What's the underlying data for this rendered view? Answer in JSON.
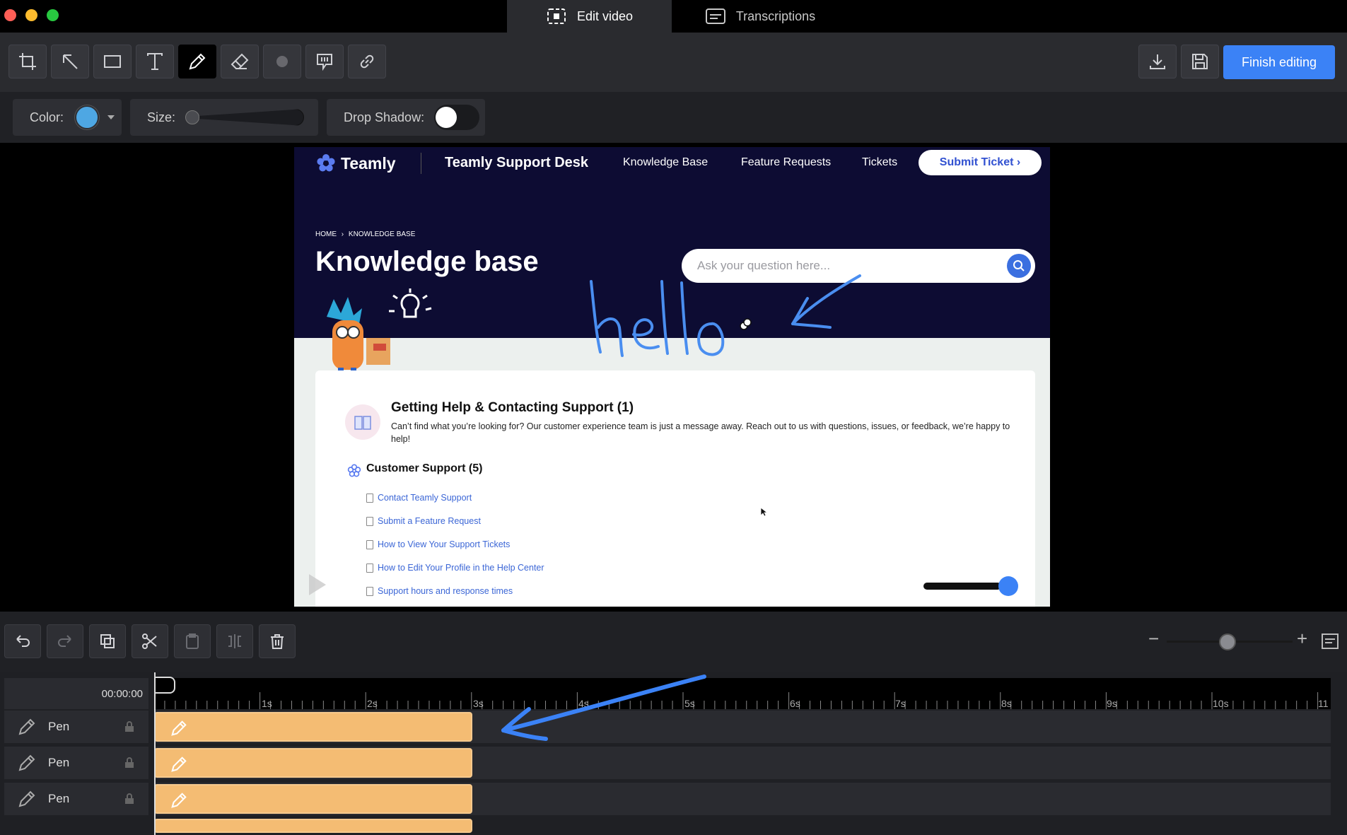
{
  "window": {
    "tabs": [
      {
        "label": "Edit video",
        "active": true,
        "icon": "edit-video-icon"
      },
      {
        "label": "Transcriptions",
        "active": false,
        "icon": "transcript-icon"
      }
    ]
  },
  "toolbar": {
    "tools": [
      "crop-icon",
      "arrow-icon",
      "rectangle-icon",
      "text-icon",
      "pen-icon",
      "eraser-icon",
      "blur-icon",
      "spotlight-icon",
      "link-icon"
    ],
    "active_tool": "pen-icon",
    "finish_label": "Finish editing"
  },
  "options": {
    "color_label": "Color:",
    "color_value": "#4ea7e3",
    "size_label": "Size:",
    "size_value": 0,
    "shadow_label": "Drop Shadow:",
    "shadow_on": false
  },
  "video": {
    "logo": "Teamly",
    "desk_title": "Teamly Support Desk",
    "nav": [
      "Knowledge Base",
      "Feature Requests",
      "Tickets"
    ],
    "submit": "Submit Ticket ›",
    "breadcrumb_home": "HOME",
    "breadcrumb_sep": "›",
    "breadcrumb_current": "KNOWLEDGE BASE",
    "title": "Knowledge base",
    "search_placeholder": "Ask your question here...",
    "annotation_text": "hello",
    "category": {
      "title": "Getting Help & Contacting Support (1)",
      "desc": "Can’t find what you’re looking for? Our customer experience team is just a message away. Reach out to us with questions, issues, or feedback, we’re happy to help!",
      "sub": "Customer Support (5)",
      "articles": [
        "Contact Teamly Support",
        "Submit a Feature Request",
        "How to View Your Support Tickets",
        "How to Edit Your Profile in the Help Center",
        "Support hours and response times"
      ]
    },
    "player_volume": 0.85
  },
  "editbar": {
    "buttons": [
      "undo-icon",
      "redo-icon",
      "duplicate-icon",
      "cut-icon",
      "paste-icon",
      "split-icon",
      "delete-icon"
    ],
    "zoom_minus": "−",
    "zoom_plus": "+",
    "zoom_level": 0.4
  },
  "timeline": {
    "time": "00:00:00",
    "ticks": [
      "1s",
      "2s",
      "3s",
      "4s",
      "5s",
      "6s",
      "7s",
      "8s",
      "9s",
      "10s",
      "11"
    ],
    "tracks": [
      {
        "name": "Pen",
        "clip_start_s": 0,
        "clip_end_s": 3
      },
      {
        "name": "Pen",
        "clip_start_s": 0,
        "clip_end_s": 3
      },
      {
        "name": "Pen",
        "clip_start_s": 0,
        "clip_end_s": 3
      }
    ]
  },
  "colors": {
    "accent": "#3b82f6",
    "clip": "#f4bc73",
    "annotation": "#4a8ef0"
  }
}
